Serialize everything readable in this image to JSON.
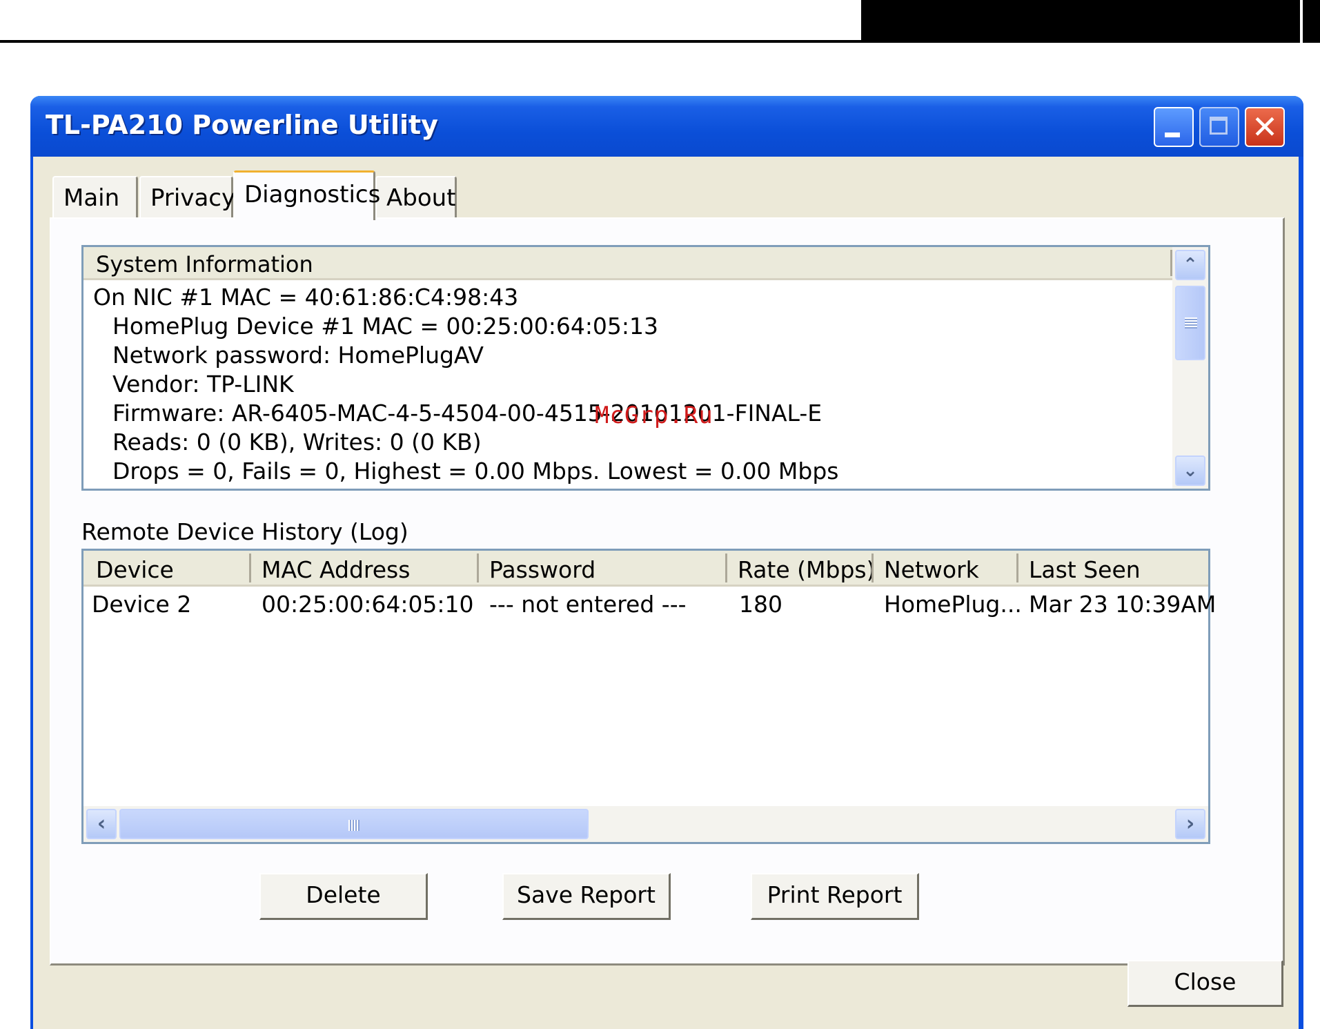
{
  "window": {
    "title": "TL-PA210 Powerline Utility",
    "controls": {
      "minimize": "_",
      "maximize": "□",
      "close": "✕"
    }
  },
  "tabs": [
    {
      "label": "Main",
      "active": false
    },
    {
      "label": "Privacy",
      "active": false
    },
    {
      "label": "Diagnostics",
      "active": true
    },
    {
      "label": "About",
      "active": false
    }
  ],
  "system_info": {
    "header": "System Information",
    "lines": [
      "On NIC #1 MAC = 40:61:86:C4:98:43",
      "HomePlug Device #1 MAC = 00:25:00:64:05:13",
      "Network password: HomePlugAV",
      "Vendor: TP-LINK",
      "Firmware: AR-6405-MAC-4-5-4504-00-4515-20101201-FINAL-E",
      "Reads: 0 (0 KB), Writes: 0 (0 KB)",
      "Drops = 0, Fails = 0, Highest = 0.00 Mbps. Lowest = 0.00 Mbps"
    ]
  },
  "log": {
    "label": "Remote Device History (Log)",
    "columns": [
      "Device",
      "MAC Address",
      "Password",
      "Rate (Mbps)",
      "Network",
      "Last Seen"
    ],
    "rows": [
      [
        "Device 2",
        "00:25:00:64:05:10",
        "--- not entered ---",
        "180",
        "HomePlug...",
        "Mar 23 10:39AM"
      ]
    ]
  },
  "buttons": {
    "delete": "Delete",
    "save_report": "Save Report",
    "print_report": "Print Report",
    "close": "Close"
  },
  "scroll_icons": {
    "up": "chevron-up-icon",
    "down": "chevron-down-icon",
    "left": "chevron-left-icon",
    "right": "chevron-right-icon"
  },
  "watermark": "McGrp.Ru",
  "colors": {
    "titlebar": "#0a4ee0",
    "client": "#ece9d8",
    "close_button": "#c8331a",
    "watermark": "#d01b1b"
  }
}
